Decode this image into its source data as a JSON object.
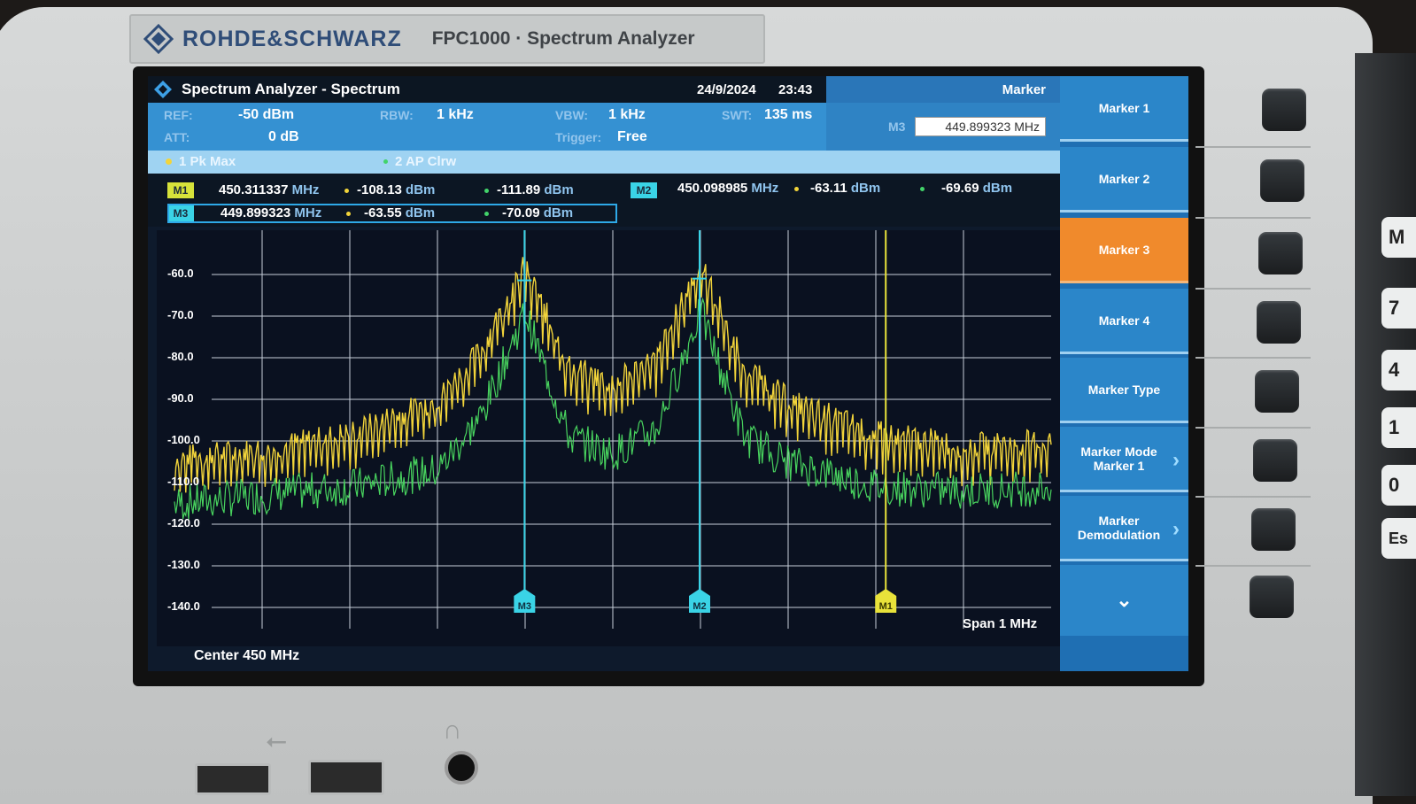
{
  "brand": {
    "name": "ROHDE&SCHWARZ",
    "model": "FPC1000 · Spectrum Analyzer"
  },
  "titlebar": {
    "title": "Spectrum Analyzer - Spectrum",
    "date": "24/9/2024",
    "time": "23:43",
    "mode": "Marker"
  },
  "params": {
    "ref_key": "REF:",
    "ref_val": "-50 dBm",
    "att_key": "ATT:",
    "att_val": "0 dB",
    "rbw_key": "RBW:",
    "rbw_val": "1 kHz",
    "vbw_key": "VBW:",
    "vbw_val": "1 kHz",
    "trig_key": "Trigger:",
    "trig_val": "Free",
    "swt_key": "SWT:",
    "swt_val": "135 ms"
  },
  "marker_input": {
    "label": "M3",
    "value": "449.899323 MHz"
  },
  "traces": [
    {
      "label": "1 Pk  Max",
      "color": "#f2d43a"
    },
    {
      "label": "2 AP  Clrw",
      "color": "#42d36a"
    }
  ],
  "markers": {
    "m1": {
      "tag": "M1",
      "freq": "450.311337",
      "unit": "MHz",
      "v1": "-108.13",
      "v2": "-111.89",
      "dbm": "dBm"
    },
    "m2": {
      "tag": "M2",
      "freq": "450.098985",
      "unit": "MHz",
      "v1": "-63.11",
      "v2": "-69.69",
      "dbm": "dBm"
    },
    "m3": {
      "tag": "M3",
      "freq": "449.899323",
      "unit": "MHz",
      "v1": "-63.55",
      "v2": "-70.09",
      "dbm": "dBm"
    }
  },
  "graph": {
    "y_ticks": [
      "-60.0",
      "-70.0",
      "-80.0",
      "-90.0",
      "-100.0",
      "-110.0",
      "-120.0",
      "-130.0",
      "-140.0"
    ],
    "center_label": "Center 450 MHz",
    "span_label": "Span 1 MHz",
    "marker_flags": {
      "m1": "M1",
      "m2": "M2",
      "m3": "M3"
    }
  },
  "chart_data": {
    "type": "line",
    "ylim": [
      -145,
      -55
    ],
    "xlim": [
      449.5,
      450.5
    ],
    "y_ticks": [
      -60,
      -70,
      -80,
      -90,
      -100,
      -110,
      -120,
      -130,
      -140
    ],
    "grid": true,
    "series": [
      {
        "name": "1 Pk Max",
        "color": "#f2d43a",
        "x": [
          449.5,
          449.6,
          449.7,
          449.8,
          449.85,
          449.9,
          449.95,
          450.0,
          450.05,
          450.1,
          450.15,
          450.2,
          450.3,
          450.4,
          450.5
        ],
        "y": [
          -110,
          -108,
          -104,
          -96,
          -84,
          -63.55,
          -88,
          -92,
          -86,
          -63.11,
          -88,
          -96,
          -104,
          -107,
          -106
        ]
      },
      {
        "name": "2 AP Clrw",
        "color": "#42d36a",
        "x": [
          449.5,
          449.6,
          449.7,
          449.8,
          449.85,
          449.9,
          449.95,
          450.0,
          450.05,
          450.1,
          450.15,
          450.2,
          450.3,
          450.4,
          450.5
        ],
        "y": [
          -116,
          -114,
          -112,
          -108,
          -95,
          -70.09,
          -100,
          -104,
          -98,
          -69.69,
          -100,
          -106,
          -111.89,
          -113,
          -112
        ]
      }
    ],
    "markers": [
      {
        "name": "M1",
        "x": 450.311337,
        "y": -108.13
      },
      {
        "name": "M2",
        "x": 450.098985,
        "y": -63.11
      },
      {
        "name": "M3",
        "x": 449.899323,
        "y": -63.55
      }
    ]
  },
  "softkeys": [
    {
      "label": "Marker 1",
      "active": false
    },
    {
      "label": "Marker 2",
      "active": false
    },
    {
      "label": "Marker 3",
      "active": true
    },
    {
      "label": "Marker 4",
      "active": false
    },
    {
      "label": "Marker Type",
      "active": false
    },
    {
      "label": "Marker Mode Marker 1",
      "active": false
    },
    {
      "label": "Marker Demodulation",
      "active": false
    }
  ],
  "softkey_more": "⌄",
  "side_keys": [
    "M",
    "7",
    "4",
    "1",
    "0",
    "Es"
  ]
}
